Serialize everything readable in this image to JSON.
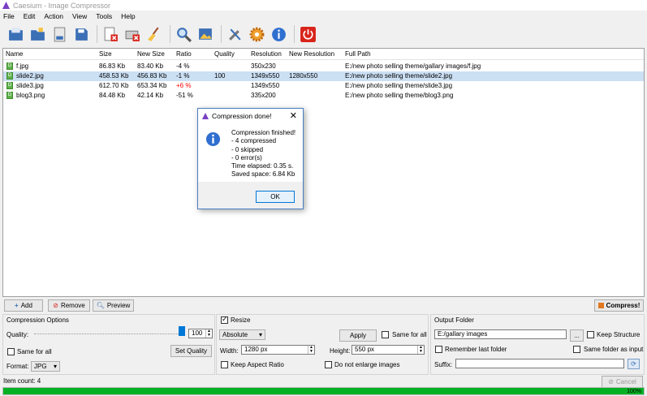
{
  "window": {
    "title": "Caesium - Image Compressor"
  },
  "menu": [
    "File",
    "Edit",
    "Action",
    "View",
    "Tools",
    "Help"
  ],
  "toolbar": [
    "open-icon",
    "open-folder-icon",
    "save-list-icon",
    "save-icon",
    "remove-icon",
    "clear-icon",
    "broom-icon",
    "search-icon",
    "preview-icon",
    "tools-icon",
    "settings-icon",
    "info-icon",
    "power-icon"
  ],
  "list": {
    "headers": {
      "name": "Name",
      "size": "Size",
      "new_size": "New Size",
      "ratio": "Ratio",
      "quality": "Quality",
      "resolution": "Resolution",
      "new_resolution": "New Resolution",
      "full_path": "Full Path"
    },
    "rows": [
      {
        "name": "f.jpg",
        "size": "86.83 Kb",
        "new_size": "83.40 Kb",
        "ratio": "-4 %",
        "quality": "",
        "resolution": "350x230",
        "new_resolution": "",
        "full_path": "E:/new photo selling theme/gallary images/f.jpg"
      },
      {
        "name": "slide2.jpg",
        "size": "458.53 Kb",
        "new_size": "456.83 Kb",
        "ratio": "-1 %",
        "quality": "100",
        "resolution": "1349x550",
        "new_resolution": "1280x550",
        "full_path": "E:/new photo selling theme/slide2.jpg"
      },
      {
        "name": "slide3.jpg",
        "size": "612.70 Kb",
        "new_size": "653.34 Kb",
        "ratio": "+6 %",
        "quality": "",
        "resolution": "1349x550",
        "new_resolution": "",
        "full_path": "E:/new photo selling theme/slide3.jpg"
      },
      {
        "name": "blog3.png",
        "size": "84.48 Kb",
        "new_size": "42.14 Kb",
        "ratio": "-51 %",
        "quality": "",
        "resolution": "335x200",
        "new_resolution": "",
        "full_path": "E:/new photo selling theme/blog3.png"
      }
    ]
  },
  "buttons": {
    "add": "Add",
    "remove": "Remove",
    "preview": "Preview",
    "compress": "Compress!"
  },
  "compression": {
    "title": "Compression Options",
    "quality_label": "Quality:",
    "quality_value": "100",
    "same_for_all": "Same for all",
    "set_quality": "Set Quality",
    "format_label": "Format:",
    "format_value": "JPG"
  },
  "resize": {
    "title": "Resize",
    "mode": "Absolute",
    "apply": "Apply",
    "same_for_all": "Same for all",
    "width_label": "Width:",
    "width_value": "1280 px",
    "height_label": "Height:",
    "height_value": "550 px",
    "keep_aspect": "Keep Aspect Ratio",
    "no_enlarge": "Do not enlarge images"
  },
  "output": {
    "title": "Output Folder",
    "path": "E:/gallary images",
    "browse": "...",
    "keep_structure": "Keep Structure",
    "remember": "Remember last folder",
    "same_as_input": "Same folder as input",
    "suffix_label": "Suffix:"
  },
  "status": {
    "item_count": "Item count: 4",
    "cancel": "Cancel",
    "progress_label": "100%",
    "progress": 1.0
  },
  "dialog": {
    "title": "Compression done!",
    "lines": [
      "Compression finished!",
      "- 4 compressed",
      "- 0 skipped",
      "- 0 error(s)",
      "Time elapsed: 0.35 s.",
      "Saved space: 6.84 Kb"
    ],
    "ok": "OK"
  },
  "colors": {
    "accent": "#0078d7",
    "selected_row": "#cce0f4",
    "progress": "#06b025",
    "negative_ratio": "#ff0000"
  }
}
